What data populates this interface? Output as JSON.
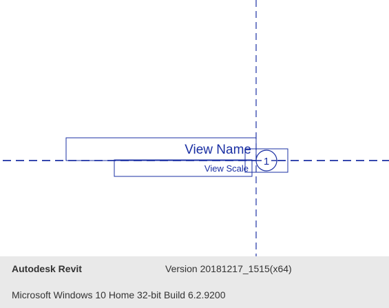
{
  "canvas": {
    "view_title": {
      "view_name": "View Name",
      "view_scale": "View Scale",
      "bubble_number": "1"
    },
    "line_color": "#1a2fa3"
  },
  "statusbar": {
    "app_name": "Autodesk Revit",
    "version": "Version 20181217_1515(x64)",
    "os_info": "Microsoft Windows 10 Home 32-bit Build 6.2.9200"
  }
}
